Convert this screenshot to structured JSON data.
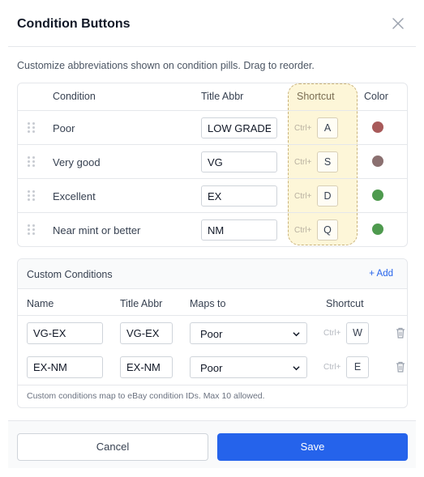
{
  "header": {
    "title": "Condition Buttons"
  },
  "description": "Customize abbreviations shown on condition pills. Drag to reorder.",
  "conditions_table": {
    "headers": {
      "condition": "Condition",
      "title_abbr": "Title Abbr",
      "shortcut": "Shortcut",
      "color": "Color"
    },
    "ctrl_label": "Ctrl+",
    "rows": [
      {
        "condition": "Poor",
        "abbr": "LOW GRADE",
        "key": "A",
        "color": "#a85a5a"
      },
      {
        "condition": "Very good",
        "abbr": "VG",
        "key": "S",
        "color": "#8b7070"
      },
      {
        "condition": "Excellent",
        "abbr": "EX",
        "key": "D",
        "color": "#4e9a4e"
      },
      {
        "condition": "Near mint or better",
        "abbr": "NM",
        "key": "Q",
        "color": "#4e9a4e"
      }
    ]
  },
  "custom_conditions": {
    "title": "Custom Conditions",
    "add_label": "+ Add",
    "headers": {
      "name": "Name",
      "title_abbr": "Title Abbr",
      "maps_to": "Maps to",
      "shortcut": "Shortcut"
    },
    "ctrl_label": "Ctrl+",
    "rows": [
      {
        "name": "VG-EX",
        "abbr": "VG-EX",
        "maps_to": "Poor",
        "key": "W"
      },
      {
        "name": "EX-NM",
        "abbr": "EX-NM",
        "maps_to": "Poor",
        "key": "E"
      }
    ],
    "note": "Custom conditions map to eBay condition IDs. Max 10 allowed."
  },
  "footer": {
    "cancel_label": "Cancel",
    "save_label": "Save"
  },
  "colors": {
    "accent": "#2563eb",
    "shortcut_highlight": "#fdf6d8"
  }
}
